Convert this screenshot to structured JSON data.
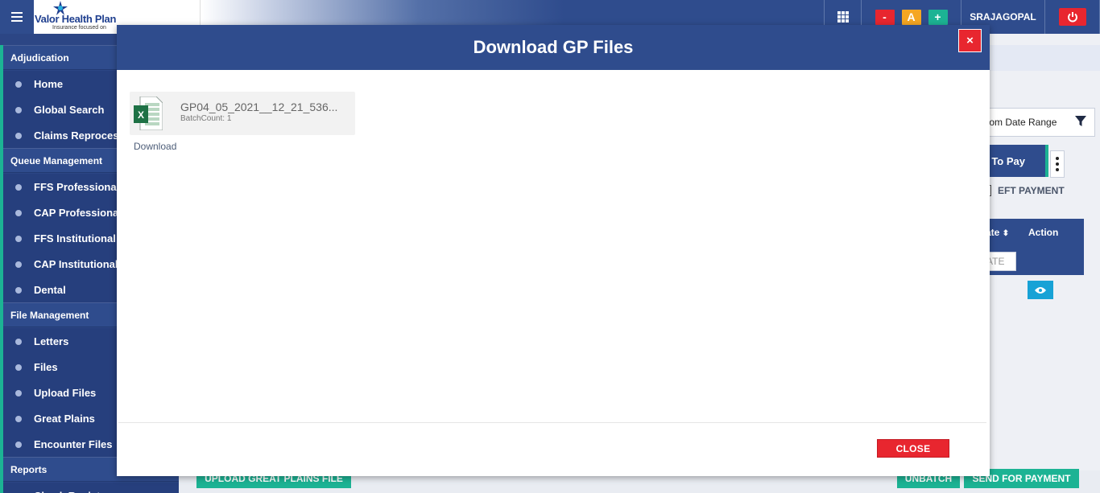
{
  "header": {
    "logo_text": "Valor Health Plan",
    "logo_tagline": "Insurance focused on",
    "menu_icon": "hamburger-icon",
    "apps_icon": "grid-icon",
    "font_decrease": "-",
    "font_reset": "A",
    "font_increase": "+",
    "username": "SRAJAGOPAL",
    "power_icon": "power-icon",
    "colors": {
      "brand": "#2f4c8d",
      "danger": "#e8262f",
      "warning": "#f5a623",
      "success": "#1cb394"
    }
  },
  "sidebar": {
    "sections": [
      {
        "label": "Adjudication",
        "items": [
          "Home",
          "Global Search",
          "Claims Reprocess"
        ]
      },
      {
        "label": "Queue Management",
        "items": [
          "FFS Professional",
          "CAP Professional",
          "FFS Institutional",
          "CAP Institutional",
          "Dental"
        ]
      },
      {
        "label": "File Management",
        "items": [
          "Letters",
          "Files",
          "Upload Files",
          "Great Plains",
          "Encounter Files"
        ]
      },
      {
        "label": "Reports",
        "items": [
          "Check Register"
        ]
      }
    ]
  },
  "background": {
    "date_range_label": "tom Date Range",
    "tab_label": "n To Pay",
    "eft_label": "EFT PAYMENT",
    "col_date": "ate",
    "col_action": "Action",
    "date_placeholder": "ATE",
    "upload_btn": "UPLOAD GREAT PLAINS FILE",
    "unbatch_btn": "UNBATCH",
    "send_btn": "SEND FOR PAYMENT"
  },
  "modal": {
    "title": "Download GP Files",
    "close_x": "×",
    "file": {
      "name": "GP04_05_2021__12_21_536...",
      "batch_count": "BatchCount: 1",
      "icon": "excel-file-icon"
    },
    "download_label": "Download",
    "close_label": "CLOSE"
  }
}
